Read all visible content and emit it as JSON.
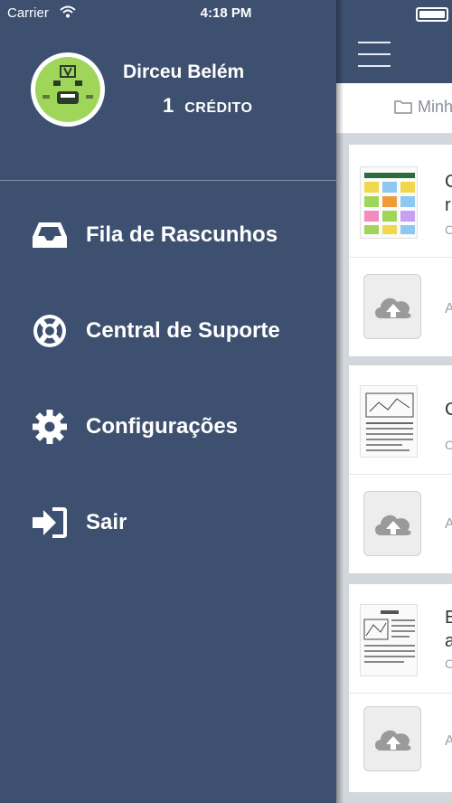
{
  "status_bar": {
    "carrier": "Carrier",
    "time": "4:18 PM",
    "battery_level": 1.0
  },
  "drawer": {
    "user": {
      "name": "Dirceu Belém",
      "credit_count": "1",
      "credit_label": "CRÉDITO"
    },
    "menu": [
      {
        "label": "Fila de Rascunhos",
        "icon": "inbox-tray-icon"
      },
      {
        "label": "Central de Suporte",
        "icon": "lifebuoy-icon"
      },
      {
        "label": "Configurações",
        "icon": "gear-icon"
      },
      {
        "label": "Sair",
        "icon": "sign-in-arrow-icon"
      }
    ]
  },
  "main": {
    "folder_label": "Minh",
    "documents": [
      {
        "title_line1": "C",
        "title_line2": "r",
        "subtitle": "C",
        "upload_label": "Ag"
      },
      {
        "title_line1": "C",
        "title_line2": "",
        "subtitle": "C",
        "upload_label": "Ag"
      },
      {
        "title_line1": "E",
        "title_line2": "a",
        "subtitle": "C",
        "upload_label": "Ag"
      }
    ]
  },
  "colors": {
    "drawer_bg": "#3e5070",
    "content_bg": "#d2d6dd",
    "avatar_green": "#9fd65a"
  }
}
